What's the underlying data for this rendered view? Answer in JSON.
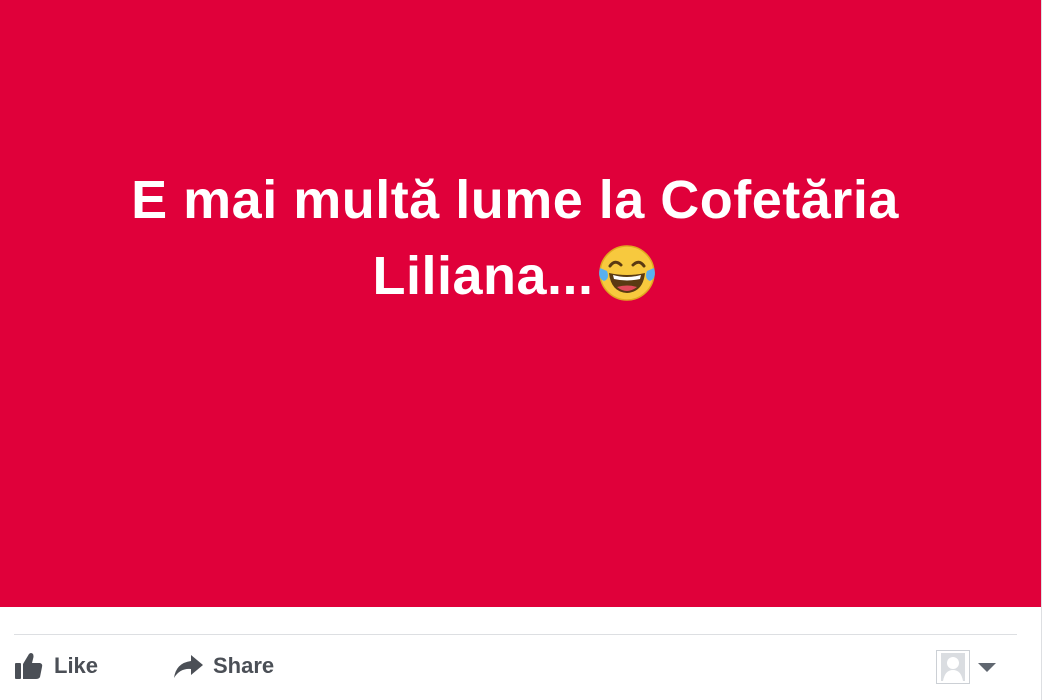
{
  "post": {
    "status_text": "E mai multă lume la Cofetăria Liliana...",
    "emoji": "face-with-tears-of-joy-emoji",
    "background_color": "#e0003a",
    "text_color": "#ffffff"
  },
  "actions": {
    "like_label": "Like",
    "share_label": "Share"
  },
  "icons": {
    "like": "thumbs-up-icon",
    "share": "share-arrow-icon",
    "audience": "avatar-icon",
    "caret": "caret-down-icon"
  },
  "colors": {
    "action_text": "#4b4f56",
    "divider": "#dddfe2"
  }
}
